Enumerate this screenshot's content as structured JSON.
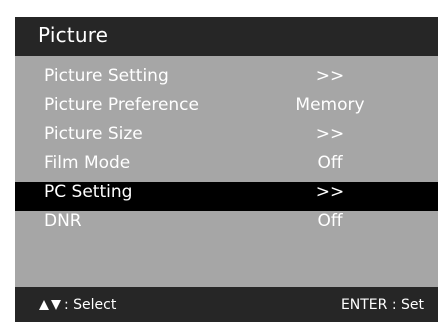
{
  "menu": {
    "title": "Picture",
    "items": [
      {
        "label": "Picture Setting",
        "value": ">>",
        "selected": false
      },
      {
        "label": "Picture Preference",
        "value": "Memory",
        "selected": false
      },
      {
        "label": "Picture Size",
        "value": ">>",
        "selected": false
      },
      {
        "label": "Film Mode",
        "value": "Off",
        "selected": false
      },
      {
        "label": "PC Setting",
        "value": ">>",
        "selected": true
      },
      {
        "label": "DNR",
        "value": "Off",
        "selected": false
      }
    ]
  },
  "footer": {
    "nav_icons": "up-down-arrow-icon",
    "select_hint": ": Select",
    "enter_hint": "ENTER : Set"
  },
  "colors": {
    "panel_background": "#a6a6a6",
    "header_background": "#262626",
    "selected_row": "#000000",
    "text": "#ffffff"
  }
}
